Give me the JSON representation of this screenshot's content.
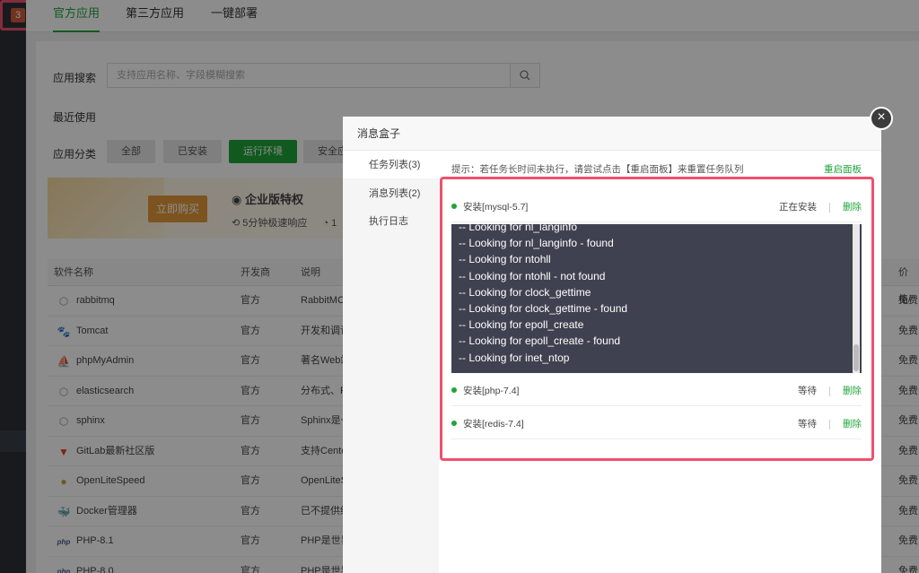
{
  "top_tabs": [
    {
      "label": "官方应用",
      "active": true
    },
    {
      "label": "第三方应用",
      "active": false
    },
    {
      "label": "一键部署",
      "active": false
    }
  ],
  "badge": "3",
  "search": {
    "label": "应用搜索",
    "placeholder": "支持应用名称、字段模糊搜索"
  },
  "recent_label": "最近使用",
  "category": {
    "label": "应用分类",
    "buttons": [
      "全部",
      "已安装",
      "运行环境",
      "安全应"
    ]
  },
  "promo": {
    "buy": "立即购买",
    "feature": "企业版特权",
    "sub1": "5分钟极速响应",
    "sub2": "1"
  },
  "table": {
    "headers": [
      "软件名称",
      "开发商",
      "说明",
      "价格/"
    ],
    "rows": [
      {
        "name": "rabbitmq",
        "vendor": "官方",
        "desc": "RabbitMC",
        "price": "免费",
        "icon": "cube-icon"
      },
      {
        "name": "Tomcat",
        "vendor": "官方",
        "desc": "开发和调试",
        "price": "免费",
        "icon": "tomcat-icon"
      },
      {
        "name": "phpMyAdmin",
        "vendor": "官方",
        "desc": "著名Web端",
        "price": "免费",
        "icon": "phpmyadmin-icon"
      },
      {
        "name": "elasticsearch",
        "vendor": "官方",
        "desc": "分布式、R",
        "price": "免费",
        "icon": "cube-icon"
      },
      {
        "name": "sphinx",
        "vendor": "官方",
        "desc": "Sphinx是一",
        "price": "免费",
        "icon": "cube-icon"
      },
      {
        "name": "GitLab最新社区版",
        "vendor": "官方",
        "desc": "支持Cento",
        "price": "免费",
        "icon": "gitlab-icon"
      },
      {
        "name": "OpenLiteSpeed",
        "vendor": "官方",
        "desc": "OpenLiteS",
        "price": "免费",
        "icon": "litespeed-icon"
      },
      {
        "name": "Docker管理器",
        "vendor": "官方",
        "desc": "已不提供维",
        "price": "免费",
        "icon": "docker-icon"
      },
      {
        "name": "PHP-8.1",
        "vendor": "官方",
        "desc": "PHP是世界",
        "price": "免费",
        "icon": "php-icon"
      },
      {
        "name": "PHP-8.0",
        "vendor": "官方",
        "desc": "PHP是世界上最好的编程语言",
        "price": "免费",
        "icon": "php-icon"
      }
    ]
  },
  "modal": {
    "title": "消息盒子",
    "side_items": [
      "任务列表(3)",
      "消息列表(2)",
      "执行日志"
    ],
    "hint": "提示：若任务长时间未执行，请尝试点击【重启面板】来重置任务队列",
    "restart": "重启面板",
    "tasks": [
      {
        "name": "安装[mysql-5.7]",
        "status": "正在安装",
        "delete": "删除"
      },
      {
        "name": "安装[php-7.4]",
        "status": "等待",
        "delete": "删除"
      },
      {
        "name": "安装[redis-7.4]",
        "status": "等待",
        "delete": "删除"
      }
    ],
    "log_lines": [
      "-- Looking for nl_langinfo",
      "-- Looking for nl_langinfo - found",
      "-- Looking for ntohll",
      "-- Looking for ntohll - not found",
      "-- Looking for clock_gettime",
      "-- Looking for clock_gettime - found",
      "-- Looking for epoll_create",
      "-- Looking for epoll_create - found",
      "-- Looking for inet_ntop"
    ]
  },
  "colors": {
    "accent": "#20a53a",
    "highlight": "#f0506e"
  }
}
